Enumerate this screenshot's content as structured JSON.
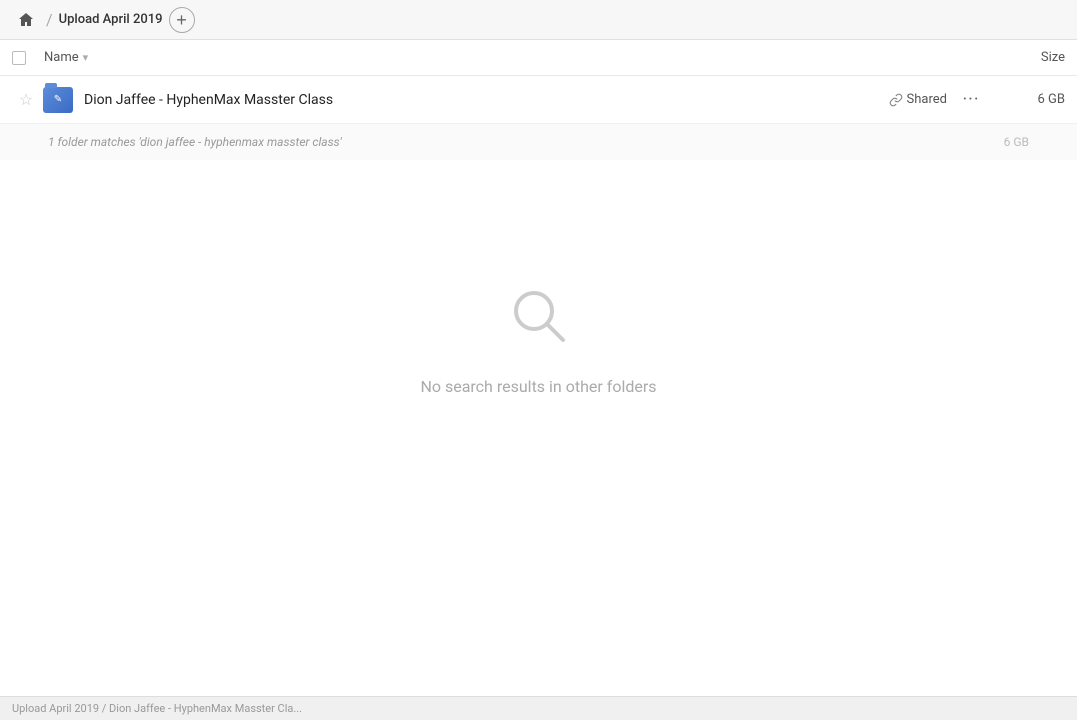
{
  "header": {
    "home_icon": "🏠",
    "breadcrumb_title": "Upload April 2019",
    "add_btn_label": "+"
  },
  "columns": {
    "name_label": "Name",
    "sort_icon": "▾",
    "size_label": "Size"
  },
  "file_row": {
    "name": "Dion Jaffee - HyphenMax Masster Class",
    "shared_label": "Shared",
    "size": "6 GB",
    "more_label": "···"
  },
  "search_info": {
    "text": "1 folder matches 'dion jaffee - hyphenmax masster class'",
    "size": "6 GB"
  },
  "no_results": {
    "text": "No search results in other folders"
  },
  "status_bar": {
    "text": "Upload April 2019 / Dion Jaffee - HyphenMax Masster Cla..."
  }
}
